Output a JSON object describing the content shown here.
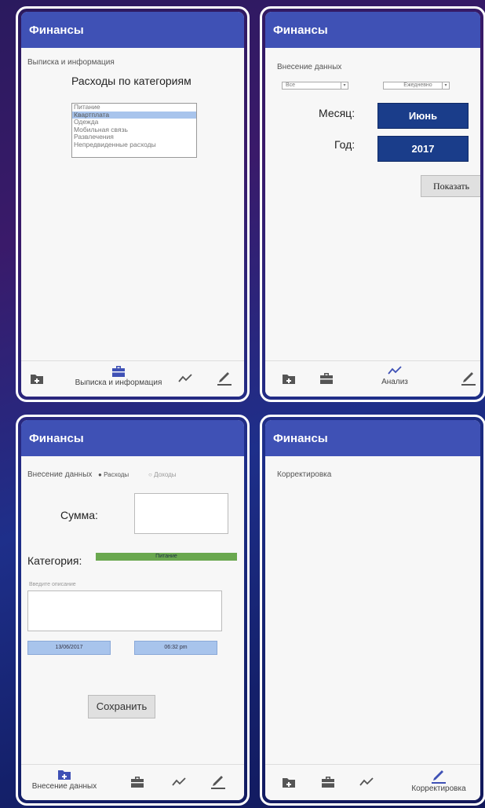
{
  "app": {
    "title": "Финансы"
  },
  "nav": {
    "add_label": "Внесение данных",
    "report_label": "Выписка и информация",
    "analysis_label": "Анализ",
    "edit_label": "Корректировка"
  },
  "screen1": {
    "section": "Выписка и информация",
    "heading": "Расходы по категориям",
    "categories": [
      "Питание",
      "Квартплата",
      "Одежда",
      "Мобильная связь",
      "Развлечения",
      "Непредвиденные расходы"
    ],
    "selected_category": "Квартплата"
  },
  "screen2": {
    "section": "Внесение данных",
    "filter_type": "Все",
    "filter_period": "Ежедневно",
    "month_label": "Месяц:",
    "month_value": "Июнь",
    "year_label": "Год:",
    "year_value": "2017",
    "show_button": "Показать"
  },
  "screen3": {
    "section": "Внесение данных",
    "radio_expenses": "Расходы",
    "radio_income": "Доходы",
    "selected_radio": "Расходы",
    "amount_label": "Сумма:",
    "amount_value": "",
    "category_label": "Категория:",
    "category_value": "Питание",
    "description_placeholder": "Введите описание",
    "date": "13/06/2017",
    "time": "06:32 pm",
    "save_button": "Сохранить"
  },
  "screen4": {
    "section": "Корректировка"
  },
  "colors": {
    "appbar": "#3f51b5",
    "accent_blue": "#1a3d8a",
    "green": "#6aa84f"
  }
}
